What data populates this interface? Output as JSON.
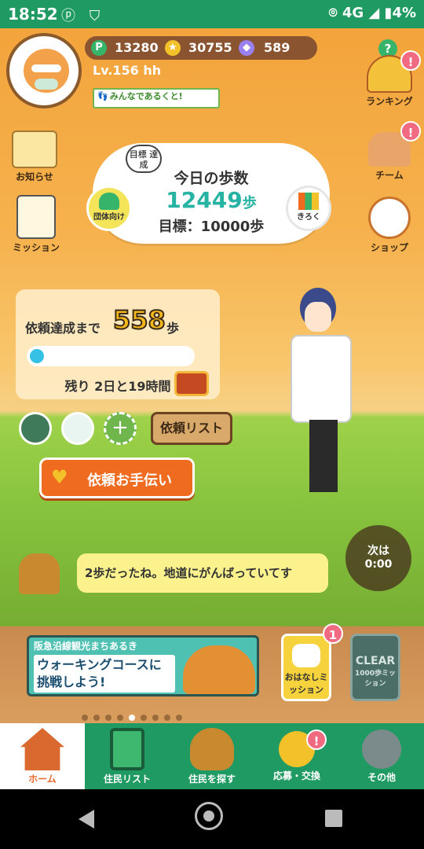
{
  "status": {
    "time": "18:52",
    "network": "4G",
    "battery": "4%"
  },
  "currency": {
    "points": "13280",
    "coins": "30755",
    "gems": "589",
    "help": "?"
  },
  "profile": {
    "level": "Lv.156 hh",
    "badge": "みんなであるくと!"
  },
  "side_left": [
    {
      "label": "お知らせ"
    },
    {
      "label": "ミッション"
    }
  ],
  "side_right": [
    {
      "label": "ランキング",
      "badge": "!"
    },
    {
      "label": "チーム",
      "badge": "!"
    },
    {
      "label": "ショップ"
    }
  ],
  "steps": {
    "bubble": "目標 達成",
    "title": "今日の歩数",
    "count": "12449",
    "unit": "歩",
    "goal": "目標：10000歩",
    "group_btn": "団体向け",
    "record_btn": "きろく"
  },
  "request": {
    "label": "依頼達成まで",
    "remaining_steps": "558",
    "unit": "歩",
    "progress": 0.04,
    "time_left": "残り 2日と19時間"
  },
  "members": {
    "list_btn": "依頼リスト",
    "add": "+"
  },
  "help_btn": "依頼お手伝い",
  "speech": "2歩だったね。地道にがんばっていてす",
  "next": {
    "line1": "次は",
    "line2": "0:00"
  },
  "banner": {
    "top": "阪急沿線観光まちあるき",
    "main": "ウォーキングコースに挑戦しよう!"
  },
  "cards": [
    {
      "label": "おはなしミッション",
      "badge": "1"
    },
    {
      "label": "CLEAR",
      "sub": "1000歩ミッション"
    }
  ],
  "carousel": {
    "count": 9,
    "active": 4
  },
  "tabs": [
    {
      "label": "ホーム"
    },
    {
      "label": "住民リスト"
    },
    {
      "label": "住民を探す"
    },
    {
      "label": "応募・交換",
      "badge": "!"
    },
    {
      "label": "その他"
    }
  ],
  "colors": {
    "green": "#1f9a62",
    "teal": "#27b3a4",
    "orange": "#ef6b1f"
  }
}
